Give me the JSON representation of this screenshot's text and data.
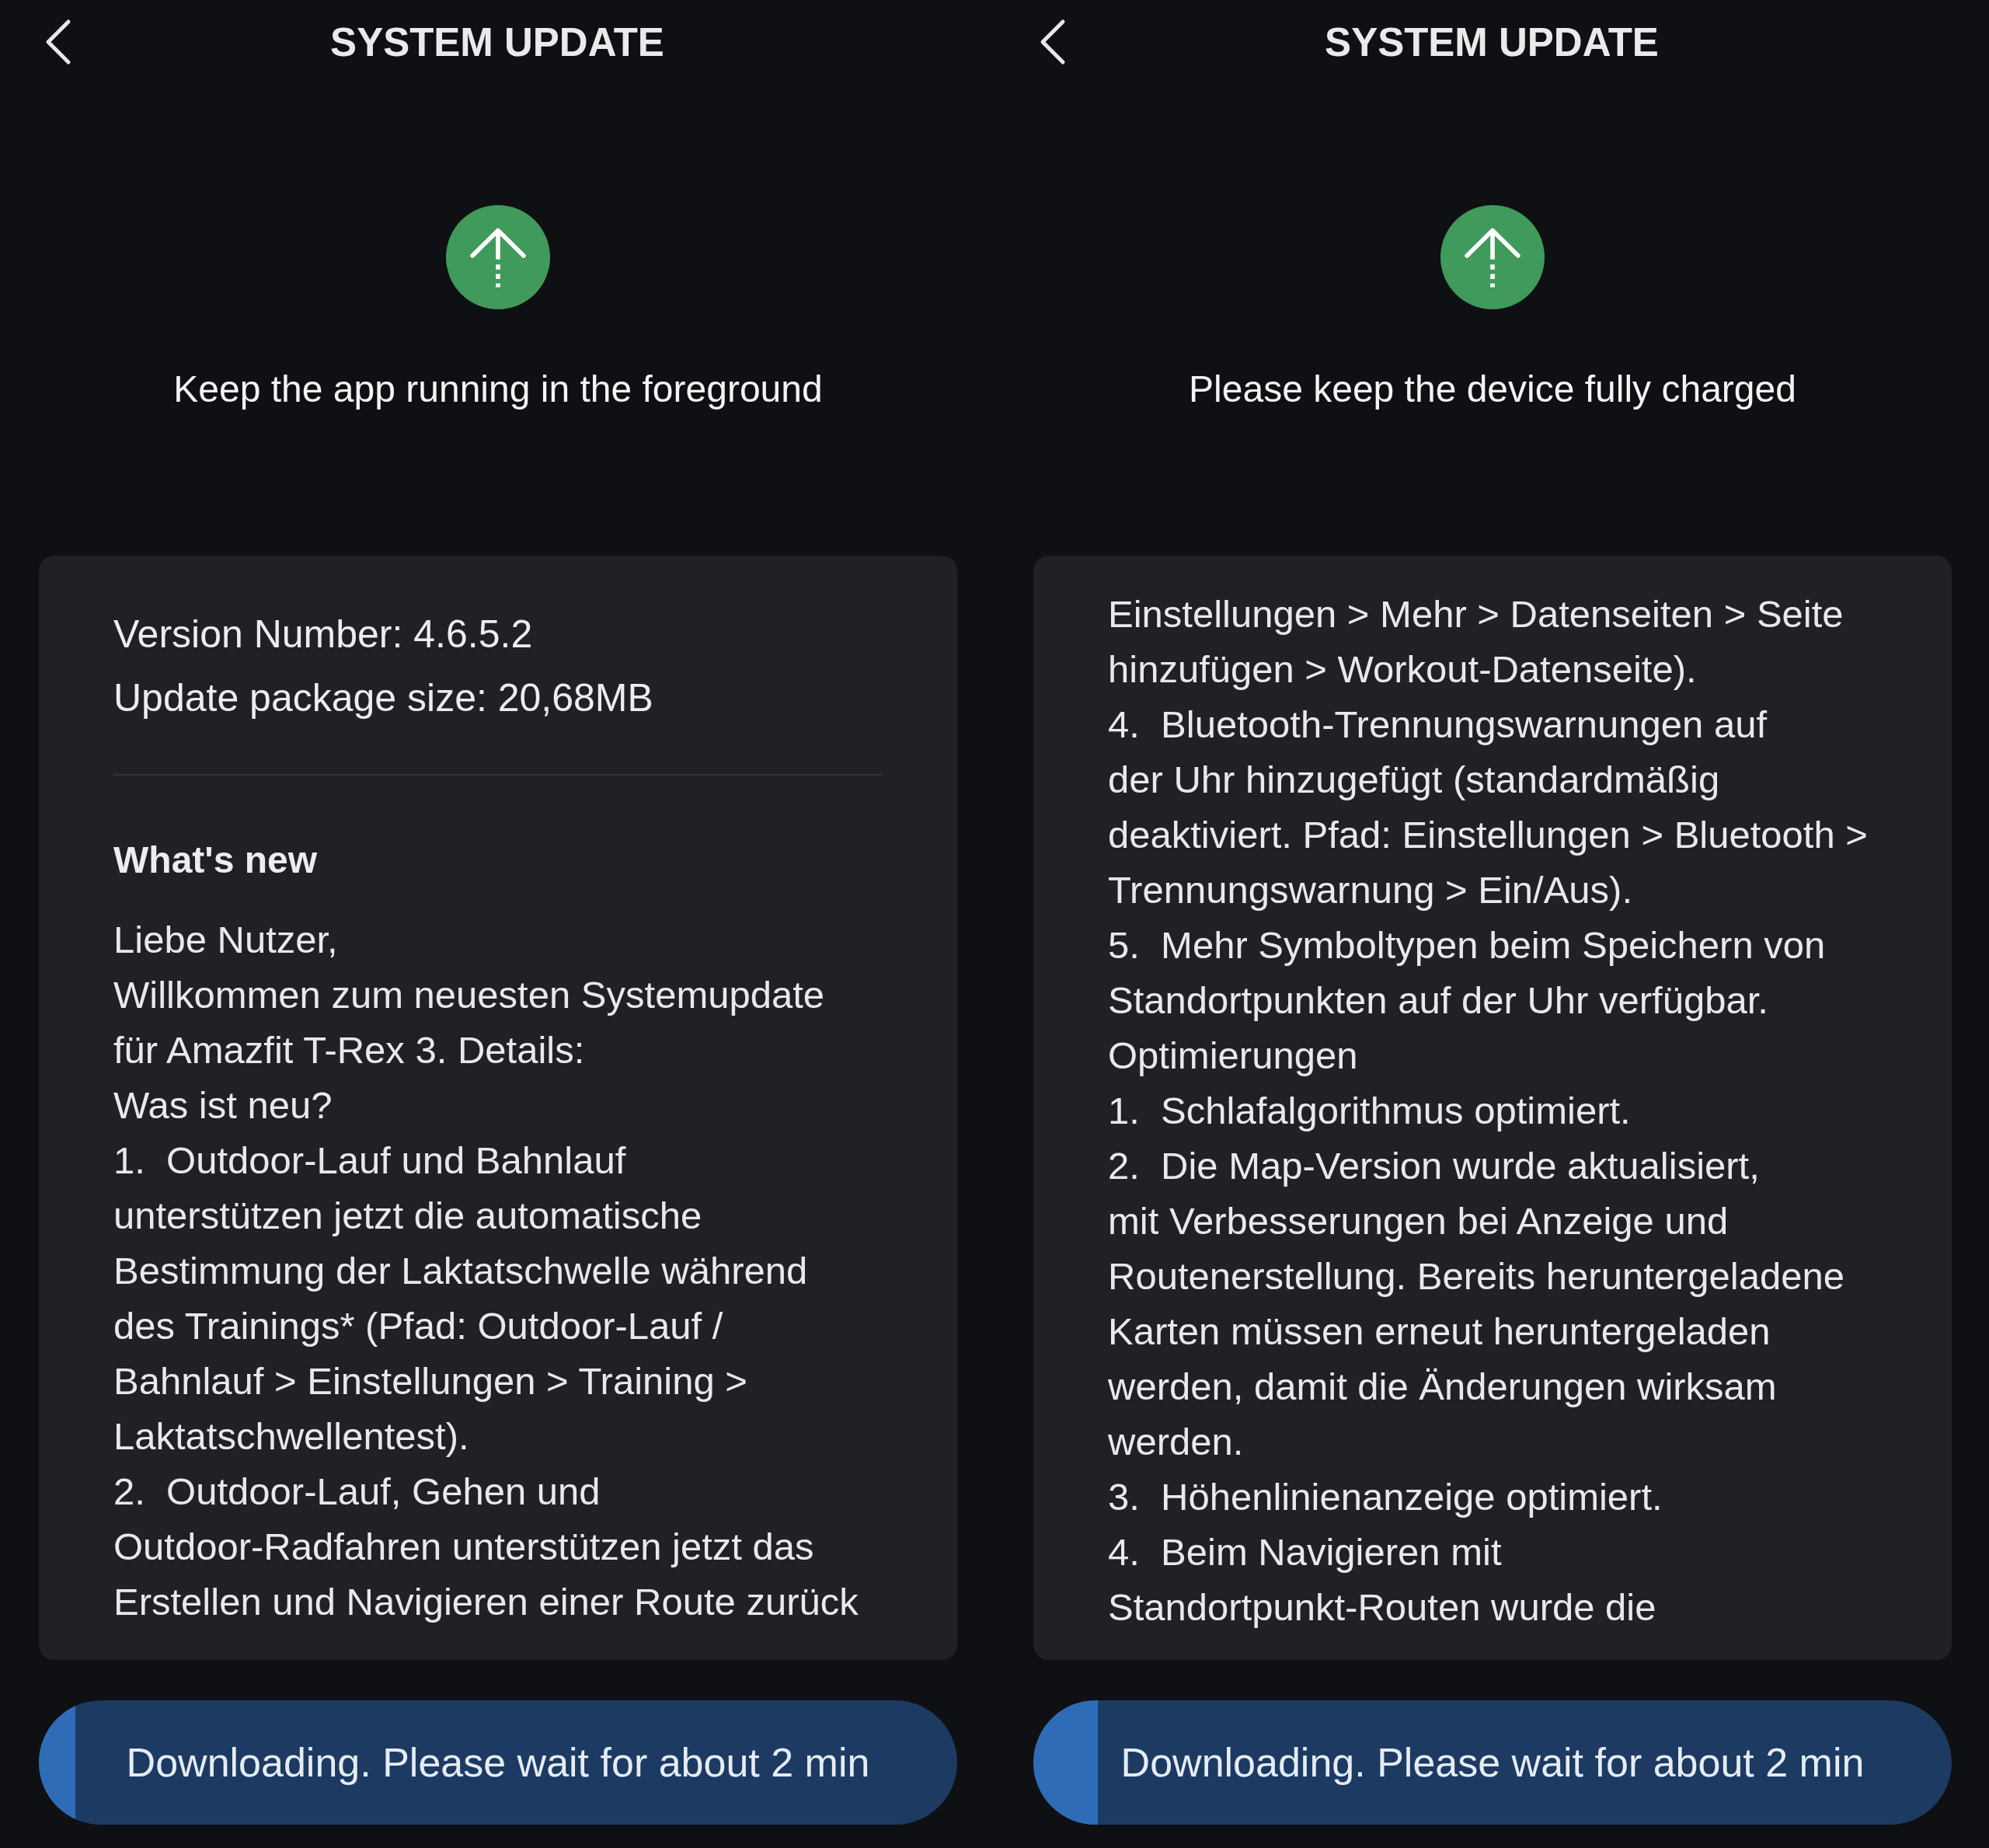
{
  "screens": [
    {
      "header": {
        "title": "SYSTEM UPDATE"
      },
      "notice": "Keep the app running in the foreground",
      "details": {
        "info_lines": [
          "Version Number: 4.6.5.2",
          "Update package size: 20,68MB"
        ],
        "whats_new_heading": "What's new",
        "paragraphs": [
          "Liebe Nutzer,",
          "Willkommen zum neuesten Systemupdate\nfür Amazfit T-Rex 3. Details:",
          "Was ist neu?",
          "1.  Outdoor-Lauf und Bahnlauf\nunterstützen jetzt die automatische\nBestimmung der Laktatschwelle während\ndes Trainings* (Pfad: Outdoor-Lauf /\nBahnlauf > Einstellungen > Training >\nLaktatschwellentest).",
          "2.  Outdoor-Lauf, Gehen und\nOutdoor-Radfahren unterstützen jetzt das\nErstellen und Navigieren einer Route zurück"
        ]
      },
      "progress": {
        "label": "Downloading. Please wait for about 2 min",
        "level": 0.04
      }
    },
    {
      "header": {
        "title": "SYSTEM UPDATE"
      },
      "notice": "Please keep the device fully charged",
      "details": {
        "paragraphs": [
          "Einstellungen > Mehr > Datenseiten > Seite\nhinzufügen > Workout-Datenseite).",
          "4.  Bluetooth-Trennungswarnungen auf\nder Uhr hinzugefügt (standardmäßig\ndeaktiviert. Pfad: Einstellungen > Bluetooth >\nTrennungswarnung > Ein/Aus).",
          "5.  Mehr Symboltypen beim Speichern von\nStandortpunkten auf der Uhr verfügbar.",
          "Optimierungen",
          "1.  Schlafalgorithmus optimiert.",
          "2.  Die Map-Version wurde aktualisiert,\nmit Verbesserungen bei Anzeige und\nRoutenerstellung. Bereits heruntergeladene\nKarten müssen erneut heruntergeladen\nwerden, damit die Änderungen wirksam\nwerden.",
          "3.  Höhenlinienanzeige optimiert.",
          "4.  Beim Navigieren mit\nStandortpunkt-Routen wurde die"
        ]
      },
      "progress": {
        "label": "Downloading. Please wait for about 2 min",
        "level": 0.07
      }
    }
  ]
}
